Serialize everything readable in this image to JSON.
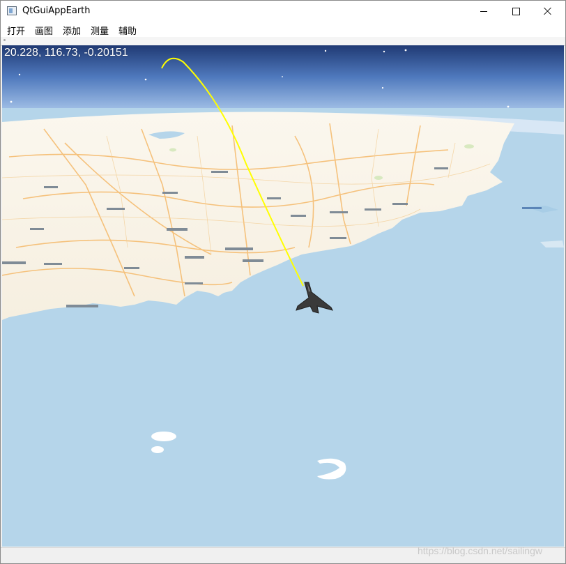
{
  "window": {
    "title": "QtGuiAppEarth",
    "controls": [
      "minimize",
      "maximize",
      "close"
    ]
  },
  "menu": {
    "items": [
      "打开",
      "画图",
      "添加",
      "测量",
      "辅助"
    ]
  },
  "map": {
    "coordinate_readout": "20.228, 116.73, -0.20151",
    "trajectory_color": "#ffff00",
    "ocean_color": "#b5d5ea",
    "land_color": "#f8f3e8",
    "aircraft_icon": "fighter-jet-icon"
  },
  "watermark": "https://blog.csdn.net/sailingw"
}
